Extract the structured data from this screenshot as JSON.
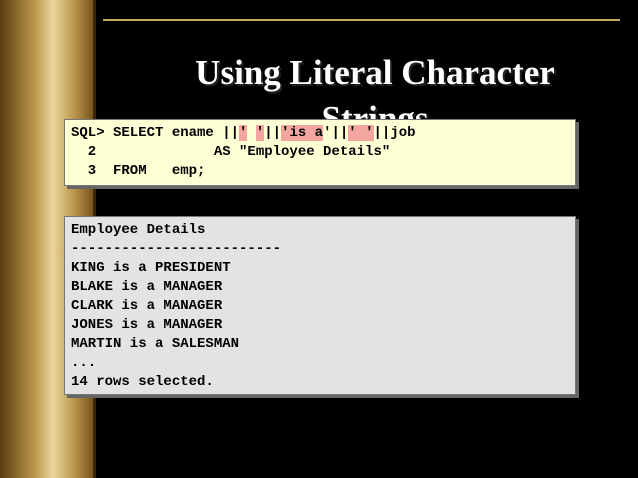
{
  "slide": {
    "title_line1": "Using Literal Character",
    "title_line2": "Strings"
  },
  "sql_panel": {
    "lines": [
      [
        {
          "text": "SQL> SELECT ename ||",
          "hl": false
        },
        {
          "text": "'",
          "hl": true
        },
        {
          "text": " ",
          "hl": false
        },
        {
          "text": "'",
          "hl": true
        },
        {
          "text": "||",
          "hl": false
        },
        {
          "text": "'is a",
          "hl": true
        },
        {
          "text": "'||",
          "hl": false
        },
        {
          "text": "' '",
          "hl": true
        },
        {
          "text": "||job",
          "hl": false
        }
      ],
      [
        {
          "text": "  2              AS \"Employee Details\"",
          "hl": false
        }
      ],
      [
        {
          "text": "  3  FROM   emp;",
          "hl": false
        }
      ]
    ]
  },
  "result_panel": {
    "lines": [
      "Employee Details",
      "-------------------------",
      "KING is a PRESIDENT",
      "BLAKE is a MANAGER",
      "CLARK is a MANAGER",
      "JONES is a MANAGER",
      "MARTIN is a SALESMAN",
      "...",
      "14 rows selected."
    ]
  }
}
